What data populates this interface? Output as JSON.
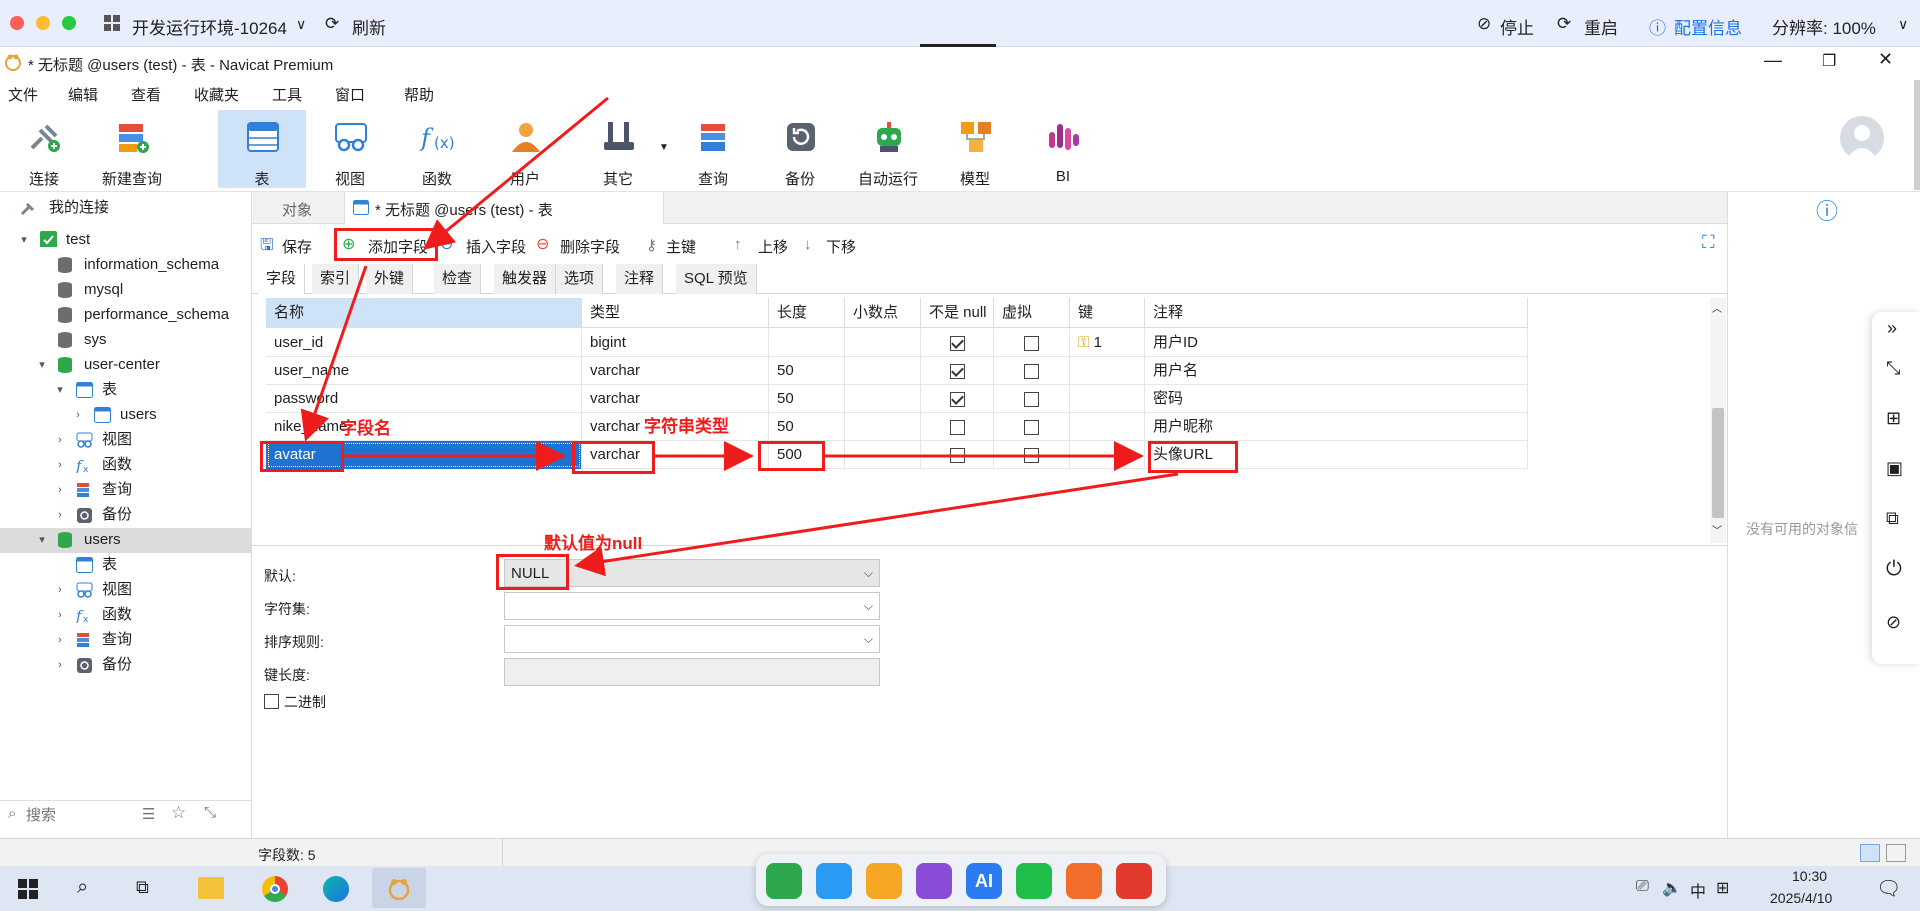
{
  "remote_bar": {
    "env_title": "开发运行环境-10264",
    "refresh": "刷新",
    "stop": "停止",
    "restart": "重启",
    "config_info": "配置信息",
    "resolution": "分辨率: 100%"
  },
  "window": {
    "title": "* 无标题 @users (test) - 表 - Navicat Premium"
  },
  "menu": [
    "文件",
    "编辑",
    "查看",
    "收藏夹",
    "工具",
    "窗口",
    "帮助"
  ],
  "toolbar": [
    "连接",
    "新建查询",
    "表",
    "视图",
    "函数",
    "用户",
    "其它",
    "查询",
    "备份",
    "自动运行",
    "模型",
    "BI"
  ],
  "sidebar": {
    "header": "我的连接",
    "items": [
      {
        "label": "test"
      },
      {
        "label": "information_schema"
      },
      {
        "label": "mysql"
      },
      {
        "label": "performance_schema"
      },
      {
        "label": "sys"
      },
      {
        "label": "user-center"
      },
      {
        "label": "表"
      },
      {
        "label": "users"
      },
      {
        "label": "视图"
      },
      {
        "label": "函数"
      },
      {
        "label": "查询"
      },
      {
        "label": "备份"
      },
      {
        "label": "users"
      },
      {
        "label": "表"
      },
      {
        "label": "视图"
      },
      {
        "label": "函数"
      },
      {
        "label": "查询"
      },
      {
        "label": "备份"
      }
    ],
    "search_placeholder": "搜索"
  },
  "tabs": {
    "objects": "对象",
    "active": "* 无标题 @users (test) - 表"
  },
  "table_toolbar": {
    "save": "保存",
    "add_field": "添加字段",
    "insert_field": "插入字段",
    "delete_field": "删除字段",
    "primary_key": "主键",
    "move_up": "上移",
    "move_down": "下移"
  },
  "subtabs": [
    "字段",
    "索引",
    "外键",
    "检查",
    "触发器",
    "选项",
    "注释",
    "SQL 预览"
  ],
  "grid": {
    "headers": [
      "名称",
      "类型",
      "长度",
      "小数点",
      "不是 null",
      "虚拟",
      "键",
      "注释"
    ],
    "rows": [
      {
        "name": "user_id",
        "type": "bigint",
        "length": "",
        "decimals": "",
        "not_null": true,
        "virtual": false,
        "key": "1",
        "comment": "用户ID"
      },
      {
        "name": "user_name",
        "type": "varchar",
        "length": "50",
        "decimals": "",
        "not_null": true,
        "virtual": false,
        "key": "",
        "comment": "用户名"
      },
      {
        "name": "password",
        "type": "varchar",
        "length": "50",
        "decimals": "",
        "not_null": true,
        "virtual": false,
        "key": "",
        "comment": "密码"
      },
      {
        "name": "nike_name",
        "type": "varchar",
        "length": "50",
        "decimals": "",
        "not_null": false,
        "virtual": false,
        "key": "",
        "comment": "用户昵称"
      },
      {
        "name": "avatar",
        "type": "varchar",
        "length": "500",
        "decimals": "",
        "not_null": false,
        "virtual": false,
        "key": "",
        "comment": "头像URL"
      }
    ]
  },
  "properties": {
    "default_label": "默认:",
    "default_value": "NULL",
    "charset_label": "字符集:",
    "collation_label": "排序规则:",
    "key_length_label": "键长度:",
    "binary_label": "二进制"
  },
  "right_panel": {
    "empty_text": "没有可用的对象信"
  },
  "status": {
    "field_count": "字段数: 5"
  },
  "annotations": {
    "field_name": "字段名",
    "string_type": "字符串类型",
    "default_null": "默认值为null"
  },
  "taskbar": {
    "time": "10:30",
    "date": "2025/4/10",
    "ime": "中",
    "dock_ai": "AI"
  },
  "colors": {
    "selection": "#1e73d2",
    "annotation": "#ef1c1c",
    "remote_link": "#1a73e8"
  }
}
